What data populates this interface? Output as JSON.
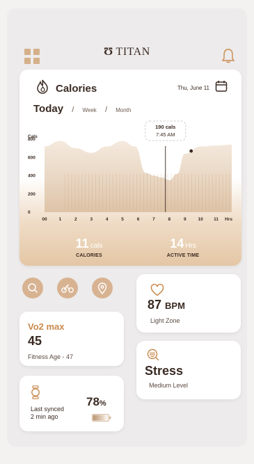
{
  "app": {
    "brand_mark": "Ʊ",
    "brand_name": "TITAN"
  },
  "header": {
    "menu_icon": "grid-icon",
    "notification_icon": "bell-icon"
  },
  "calories_card": {
    "title": "Calories",
    "date": "Thu, June 11",
    "tabs": [
      "Today",
      "Week",
      "Month"
    ],
    "selected_tab": "Today",
    "tooltip_value": "190 cals",
    "tooltip_time": "7:45 AM",
    "calories_value": "11",
    "calories_unit": "cals",
    "calories_label": "CALORIES",
    "active_value": "14",
    "active_unit": "Hrs",
    "active_label": "ACTIVE TIME"
  },
  "chart_data": {
    "type": "area",
    "ylabel": "Cals",
    "xlabel": "Hrs",
    "y_ticks": [
      "800",
      "600",
      "400",
      "200",
      "0"
    ],
    "x_ticks": [
      "00",
      "1",
      "2",
      "3",
      "4",
      "5",
      "6",
      "7",
      "8",
      "9",
      "10",
      "11",
      "Hrs"
    ],
    "ylim": [
      0,
      800
    ],
    "x": [
      0,
      1,
      2,
      3,
      4,
      5,
      5.8,
      6.5,
      7,
      7.5,
      8,
      8.5,
      9,
      10,
      11,
      12
    ],
    "values": [
      720,
      780,
      700,
      650,
      720,
      780,
      720,
      430,
      400,
      380,
      350,
      420,
      640,
      720,
      730,
      740
    ],
    "highlight": {
      "x": 7.75,
      "value": 190,
      "label": "190 cals"
    }
  },
  "quick_actions": [
    "search-icon",
    "bike-icon",
    "location-icon"
  ],
  "vo2": {
    "title": "Vo2 max",
    "value": "45",
    "subtitle": "Fitness Age - 47"
  },
  "sync": {
    "text_line1": "Last synced",
    "text_line2": "2 min ago",
    "battery_value": "78",
    "battery_unit": "%",
    "battery_level": 0.78
  },
  "heart": {
    "value": "87",
    "unit": "BPM",
    "subtitle": "Light Zone"
  },
  "stress": {
    "title": "Stress",
    "subtitle": "Medium Level"
  },
  "colors": {
    "accent": "#c98a4e",
    "chart_fill": "#d8b392",
    "button_fill": "#d8b392"
  }
}
